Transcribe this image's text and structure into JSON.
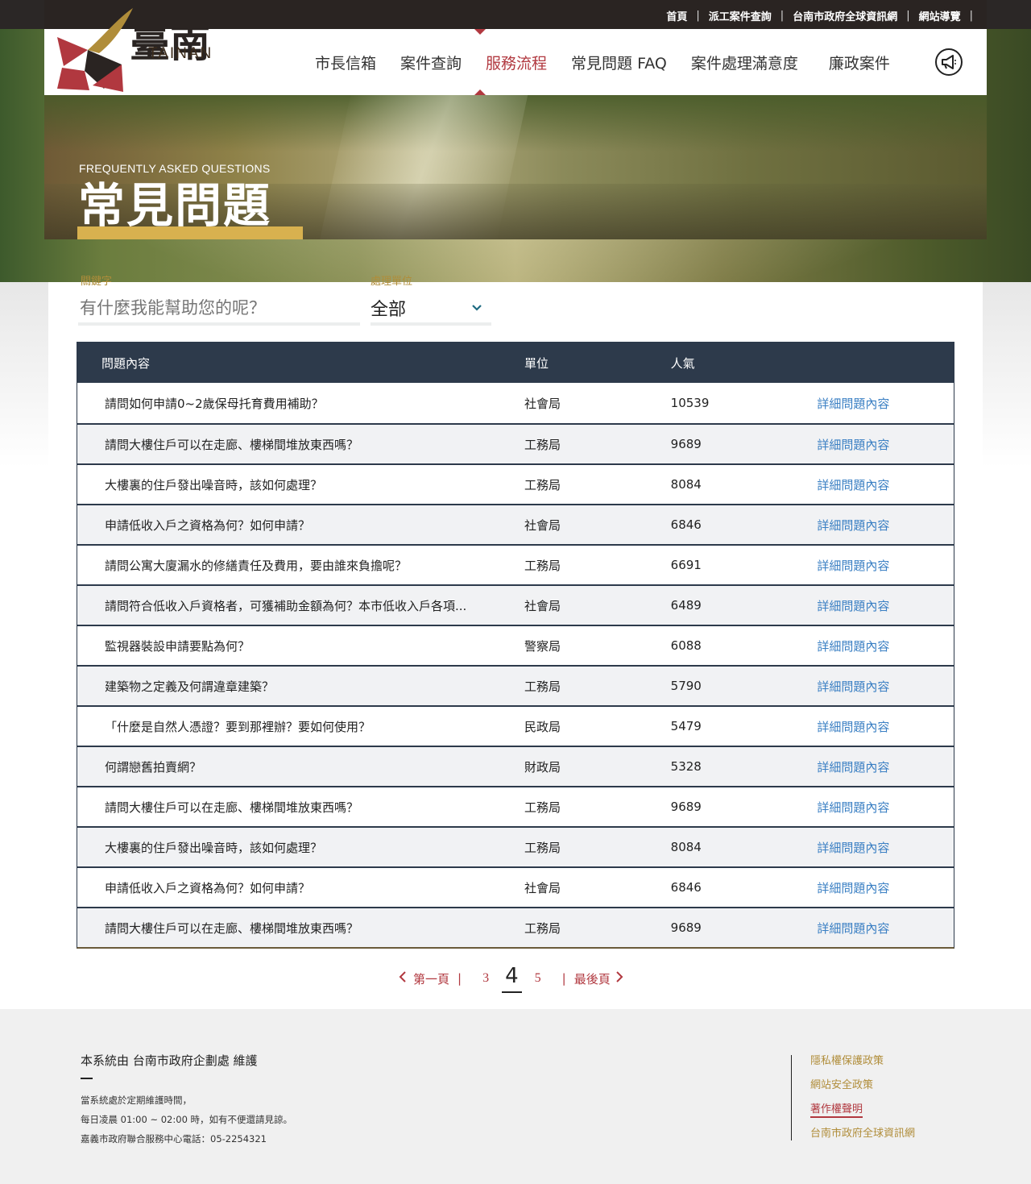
{
  "utility_nav": [
    "首頁",
    "派工案件查詢",
    "台南市政府全球資訊網",
    "網站導覽"
  ],
  "logo": {
    "chinese": "臺南",
    "english": "TAINAN"
  },
  "main_nav": [
    "市長信箱",
    "案件查詢",
    "服務流程",
    "常見問題 FAQ",
    "案件處理滿意度",
    "廉政案件"
  ],
  "active_nav": "服務流程",
  "banner": {
    "subtitle": "FREQUENTLY ASKED QUESTIONS",
    "title": "常見問題"
  },
  "filters": {
    "keyword_label": "關鍵字",
    "keyword_placeholder": "有什麼我能幫助您的呢？",
    "unit_label": "處理單位",
    "unit_value": "全部"
  },
  "table": {
    "headers": [
      "問題內容",
      "單位",
      "人氣",
      ""
    ],
    "link_label": "詳細問題內容",
    "rows": [
      {
        "q": "請問如何申請0~2歲保母托育費用補助？",
        "unit": "社會局",
        "views": "10539"
      },
      {
        "q": "請問大樓住戶可以在走廊、樓梯間堆放東西嗎？",
        "unit": "工務局",
        "views": "9689"
      },
      {
        "q": "大樓裏的住戶發出噪音時，該如何處理？",
        "unit": "工務局",
        "views": "8084"
      },
      {
        "q": "申請低收入戶之資格為何？如何申請？",
        "unit": "社會局",
        "views": "6846"
      },
      {
        "q": "請問公寓大廈漏水的修繕責任及費用，要由誰來負擔呢？",
        "unit": "工務局",
        "views": "6691"
      },
      {
        "q": "請問符合低收入戶資格者，可獲補助金額為何？本市低收入戶各項...",
        "unit": "社會局",
        "views": "6489"
      },
      {
        "q": "監視器裝設申請要點為何？",
        "unit": "警察局",
        "views": "6088"
      },
      {
        "q": "建築物之定義及何謂違章建築？",
        "unit": "工務局",
        "views": "5790"
      },
      {
        "q": "「什麼是自然人憑證？要到那裡辦？要如何使用？",
        "unit": "民政局",
        "views": "5479"
      },
      {
        "q": "何謂戀舊拍賣網？",
        "unit": "財政局",
        "views": "5328"
      },
      {
        "q": "請問大樓住戶可以在走廊、樓梯間堆放東西嗎？",
        "unit": "工務局",
        "views": "9689"
      },
      {
        "q": "大樓裏的住戶發出噪音時，該如何處理？",
        "unit": "工務局",
        "views": "8084"
      },
      {
        "q": "申請低收入戶之資格為何？如何申請？",
        "unit": "社會局",
        "views": "6846"
      },
      {
        "q": "請問大樓住戶可以在走廊、樓梯間堆放東西嗎？",
        "unit": "工務局",
        "views": "9689"
      }
    ]
  },
  "pagination": {
    "first": "第一頁",
    "prev_page": "3",
    "current": "4",
    "next_page": "5",
    "last": "最後頁"
  },
  "footer": {
    "maintainer": "本系統由 台南市政府企劃處 維護",
    "lines": [
      "當系統處於定期維護時間，",
      "每日凌晨 01:00 ~ 02:00 時，如有不便還請見諒。",
      "嘉義市政府聯合服務中心電話：05-2254321"
    ],
    "links": [
      "隱私權保護政策",
      "網站安全政策",
      "著作權聲明",
      "台南市政府全球資訊網"
    ],
    "active_link": "著作權聲明"
  },
  "colors": {
    "accent": "#b1383f",
    "gold": "#b08d3a",
    "table_header": "#2d3a4b",
    "link": "#3a7fc3"
  }
}
